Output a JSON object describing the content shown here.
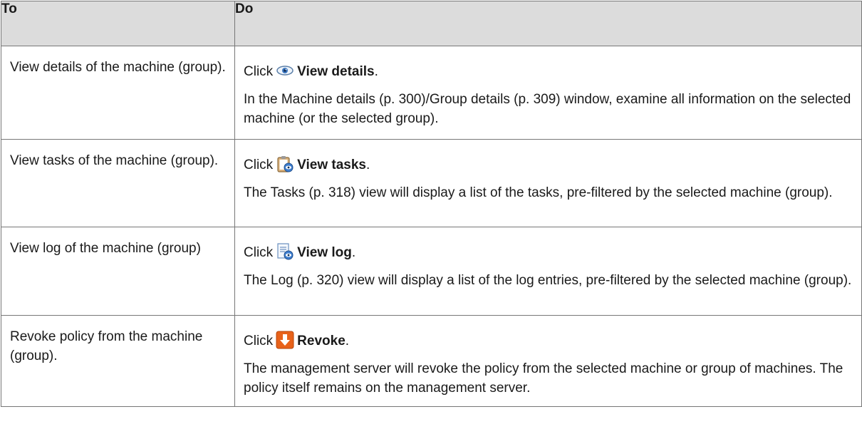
{
  "table": {
    "headers": {
      "to": "To",
      "do": "Do"
    },
    "rows": [
      {
        "to": "View details of the machine (group).",
        "click": "Click",
        "icon": "eye-icon",
        "action": "View details",
        "period": ".",
        "result": "In the Machine details (p. 300)/Group details (p. 309) window, examine all information on the selected machine (or the selected group)."
      },
      {
        "to": "View tasks of the machine (group).",
        "click": "Click",
        "icon": "clipboard-eye-icon",
        "action": "View tasks",
        "period": ".",
        "result": "The Tasks (p. 318) view will display a list of the tasks, pre-filtered by the selected machine (group)."
      },
      {
        "to": "View log of the machine (group)",
        "click": "Click",
        "icon": "log-eye-icon",
        "action": "View log",
        "period": ".",
        "result": "The Log (p. 320) view will display a list of the log entries, pre-filtered by the selected machine (group)."
      },
      {
        "to": "Revoke policy from the machine (group).",
        "click": "Click",
        "icon": "revoke-arrow-icon",
        "action": "Revoke",
        "period": ".",
        "result": "The management server will revoke the policy from the selected machine or group of machines. The policy itself remains on the management server."
      }
    ]
  },
  "colors": {
    "header_bg": "#dcdcdc",
    "border": "#777777",
    "revoke_icon": "#e8621a"
  }
}
